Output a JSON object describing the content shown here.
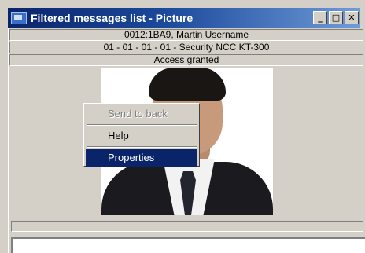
{
  "window": {
    "title": "Filtered messages list - Picture",
    "controls": {
      "minimize": "_",
      "maximize": "□",
      "close": "✕"
    }
  },
  "info": {
    "line1": "0012:1BA9, Martin Username",
    "line2": "01 - 01 - 01 - 01 - Security NCC KT-300",
    "line3": "Access granted"
  },
  "context_menu": {
    "items": [
      {
        "label": "Send to back",
        "state": "disabled"
      },
      {
        "label": "Help",
        "state": "normal"
      },
      {
        "label": "Properties",
        "state": "selected"
      }
    ]
  },
  "colors": {
    "titlebar_start": "#0a246a",
    "titlebar_end": "#6f9bd8",
    "menu_highlight": "#0a246a",
    "window_bg": "#d4d0c8"
  }
}
